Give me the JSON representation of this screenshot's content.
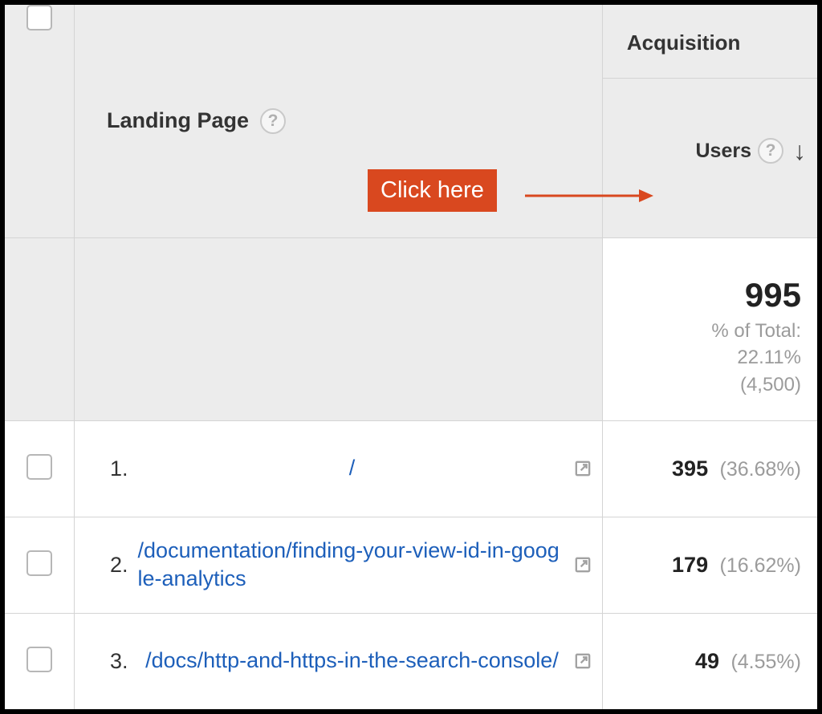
{
  "header": {
    "landing_label": "Landing Page",
    "acquisition_group": "Acquisition",
    "users_label": "Users"
  },
  "summary": {
    "users_total": "995",
    "pct_label": "% of Total:",
    "pct_value": "22.11%",
    "baseline": "(4,500)"
  },
  "rows": [
    {
      "index": "1.",
      "path": "/",
      "users": "395",
      "pct": "(36.68%)"
    },
    {
      "index": "2.",
      "path": "/documentation/finding-your-view-id-in-google-analytics",
      "users": "179",
      "pct": "(16.62%)"
    },
    {
      "index": "3.",
      "path": "/docs/http-and-https-in-the-search-console/",
      "users": "49",
      "pct": "(4.55%)"
    }
  ],
  "annotation": {
    "label": "Click here"
  }
}
